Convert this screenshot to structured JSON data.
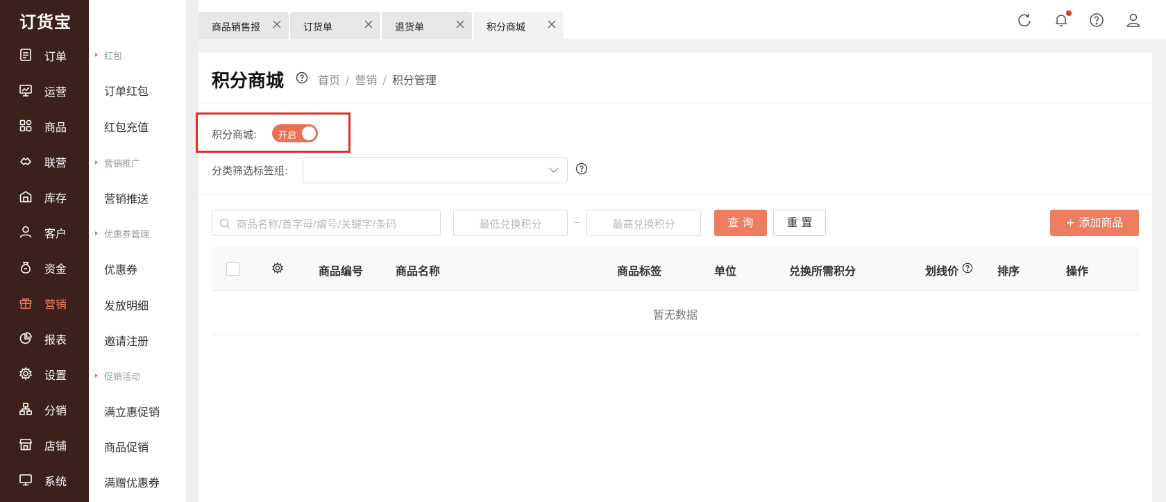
{
  "brand": {
    "logo_text": "订货宝",
    "accent": "#ea7053",
    "nav_bg": "#3b201b"
  },
  "nav": {
    "items": [
      {
        "label": "订单",
        "icon": "order-doc-icon"
      },
      {
        "label": "运营",
        "icon": "chart-board-icon"
      },
      {
        "label": "商品",
        "icon": "grid-apps-icon"
      },
      {
        "label": "联营",
        "icon": "cooperation-icon"
      },
      {
        "label": "库存",
        "icon": "warehouse-icon"
      },
      {
        "label": "客户",
        "icon": "user-icon"
      },
      {
        "label": "资金",
        "icon": "money-bag-icon"
      },
      {
        "label": "营销",
        "icon": "gift-icon",
        "active": true
      },
      {
        "label": "报表",
        "icon": "pie-chart-icon"
      },
      {
        "label": "设置",
        "icon": "gear-icon"
      },
      {
        "label": "分销",
        "icon": "org-tree-icon"
      },
      {
        "label": "店铺",
        "icon": "store-icon"
      },
      {
        "label": "系统",
        "icon": "monitor-icon"
      }
    ]
  },
  "submenu": {
    "group_hongbao": "红包",
    "item_order_hongbao": "订单红包",
    "item_hongbao_recharge": "红包充值",
    "group_promotion": "营销推广",
    "item_push": "营销推送",
    "group_coupon": "优惠券管理",
    "item_coupon": "优惠券",
    "item_issue_detail": "发放明细",
    "item_invite": "邀请注册",
    "group_activity": "促销活动",
    "item_instant_discount": "满立惠促销",
    "item_product_promo": "商品促销",
    "item_gift_coupon": "满赠优惠券"
  },
  "tabs": [
    {
      "label": "商品销售报"
    },
    {
      "label": "订货单"
    },
    {
      "label": "退货单"
    },
    {
      "label": "积分商城",
      "active": true
    }
  ],
  "header_icons": [
    "refresh-icon",
    "bell-icon",
    "help-circle-icon",
    "user-avatar-icon"
  ],
  "page": {
    "title": "积分商城",
    "breadcrumb": [
      "首页",
      "营销",
      "积分管理"
    ]
  },
  "settings": {
    "mall_label": "积分商城:",
    "mall_switch_text": "开启",
    "mall_switch_on": true,
    "category_label": "分类筛选标签组:",
    "category_value": ""
  },
  "filters": {
    "search_placeholder": "商品名称/首字母/编号/关键字/条码",
    "min_points_placeholder": "最低兑换积分",
    "range_separator": "–",
    "max_points_placeholder": "最高兑换积分",
    "query_label": "查 询",
    "reset_label": "重 置",
    "add_label": "+ 添加商品"
  },
  "table": {
    "columns": [
      "商品编号",
      "商品名称",
      "商品标签",
      "单位",
      "兑换所需积分",
      "划线价",
      "排序",
      "操作"
    ],
    "empty_text": "暂无数据"
  }
}
